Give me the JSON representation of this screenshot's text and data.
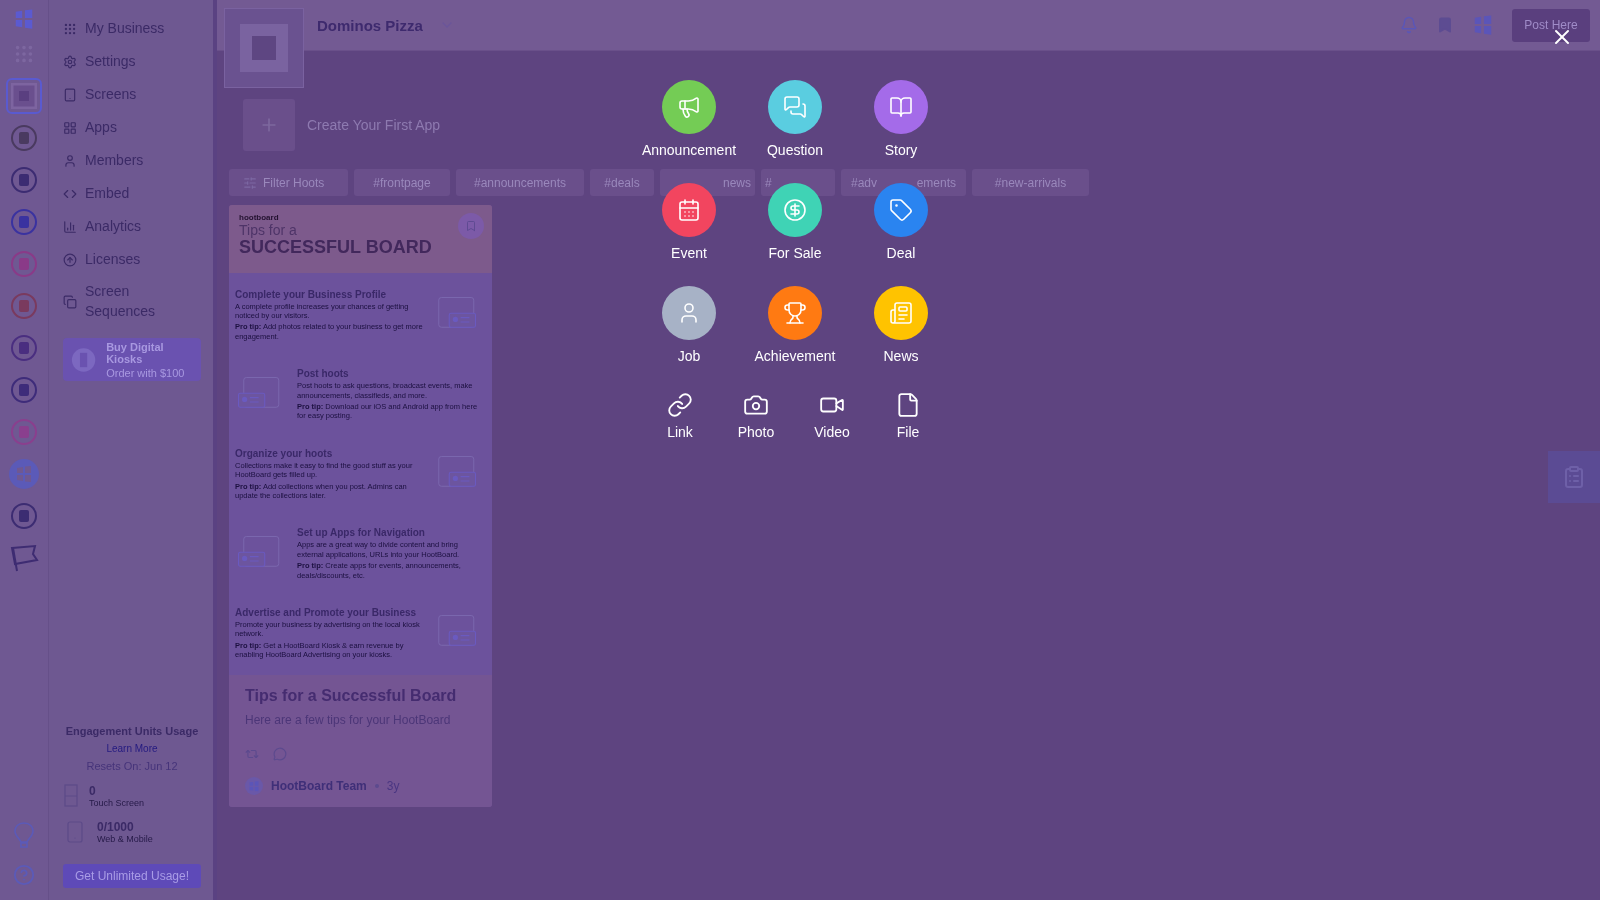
{
  "rail": {
    "items": [
      {
        "kind": "grid",
        "selected": false
      },
      {
        "kind": "board",
        "selected": true
      },
      {
        "kind": "logo",
        "selected": false
      },
      {
        "kind": "logo",
        "selected": false
      },
      {
        "kind": "logo",
        "selected": false
      },
      {
        "kind": "logo",
        "selected": false
      },
      {
        "kind": "logo",
        "selected": false
      },
      {
        "kind": "logo",
        "selected": false
      },
      {
        "kind": "logo",
        "selected": false
      },
      {
        "kind": "logo",
        "selected": false
      },
      {
        "kind": "brand",
        "selected": false
      },
      {
        "kind": "logo",
        "selected": false
      },
      {
        "kind": "flag",
        "selected": false
      }
    ]
  },
  "nav": {
    "items": [
      {
        "label": "My Business"
      },
      {
        "label": "Settings"
      },
      {
        "label": "Screens"
      },
      {
        "label": "Apps"
      },
      {
        "label": "Members"
      },
      {
        "label": "Embed"
      },
      {
        "label": "Analytics"
      },
      {
        "label": "Licenses"
      },
      {
        "label": "Screen Sequences"
      }
    ],
    "promo": {
      "title": "Buy Digital Kiosks",
      "subtitle": "Order with $100"
    },
    "usage": {
      "title": "Engagement Units Usage",
      "link": "Learn More",
      "resets": "Resets On: Jun 12",
      "meters": [
        {
          "kind": "screen",
          "value": "0",
          "label": "Touch Screen"
        },
        {
          "kind": "phone",
          "value": "0/1000",
          "label": "Web & Mobile"
        }
      ],
      "button": "Get Unlimited Usage!"
    }
  },
  "topbar": {
    "board_name": "Dominos Pizza",
    "button": "Post Here"
  },
  "create_app": {
    "label": "Create Your First App"
  },
  "filters": {
    "button": "Filter Hoots",
    "chips": [
      {
        "parts": [
          "#frontpage"
        ]
      },
      {
        "parts": [
          "#announcements"
        ]
      },
      {
        "parts": [
          "#deals"
        ]
      },
      {
        "parts": [
          "news"
        ]
      },
      {
        "parts": [
          "#"
        ]
      },
      {
        "parts": [
          "#adv",
          "ements"
        ]
      },
      {
        "parts": [
          "#new-arrivals"
        ]
      }
    ]
  },
  "card": {
    "infographic": {
      "brand": "hootboard",
      "title_top": "Tips for a",
      "title_bottom": "SUCCESSFUL BOARD",
      "sections": [
        {
          "kind": "text-first",
          "heading": "Complete your Business Profile",
          "body": "A complete profile increases your chances of getting noticed by our visitors.",
          "tip": "**Pro tip:** Add photos related to your business to get more engagement."
        },
        {
          "kind": "art-first",
          "heading": "Post hoots",
          "body": "Post hoots to ask questions, broadcast events, make announcements, classifieds, and more.",
          "tip": "**Pro tip:** Download our iOS and Android app from here for easy posting."
        },
        {
          "kind": "text-first",
          "heading": "Organize your hoots",
          "body": "Collections make it easy to find the good stuff as your HootBoard gets filled up.",
          "tip": "**Pro tip:** Add collections when you post. Admins can update the collections later."
        },
        {
          "kind": "art-first",
          "heading": "Set up Apps for Navigation",
          "body": "Apps are a great way to divide content and bring external applications, URLs into your HootBoard.",
          "tip": "**Pro tip:** Create apps for events, announcements, deals/discounts, etc."
        },
        {
          "kind": "text-first",
          "heading": "Advertise and Promote your Business",
          "body": "Promote your business by advertising on the local kiosk network.",
          "tip": "**Pro tip:** Get a HootBoard Kiosk & earn revenue by enabling HootBoard Advertising on your kiosks."
        }
      ]
    },
    "title": "Tips for a Successful Board",
    "description": "Here are a few tips for your HootBoard",
    "author": "HootBoard Team",
    "age": "3y"
  },
  "post_menu": {
    "types": [
      {
        "label": "Announcement",
        "color": "#74cc55"
      },
      {
        "label": "Question",
        "color": "#5acde0"
      },
      {
        "label": "Story",
        "color": "#a46be9"
      },
      {
        "label": "Event",
        "color": "#f2455f"
      },
      {
        "label": "For Sale",
        "color": "#3fd3b5"
      },
      {
        "label": "Deal",
        "color": "#2a84f0"
      },
      {
        "label": "Job",
        "color": "#a7b2c6"
      },
      {
        "label": "Achievement",
        "color": "#ff7a12"
      },
      {
        "label": "News",
        "color": "#ffc300"
      }
    ],
    "attachments": [
      {
        "label": "Link"
      },
      {
        "label": "Photo"
      },
      {
        "label": "Video"
      },
      {
        "label": "File"
      }
    ]
  }
}
